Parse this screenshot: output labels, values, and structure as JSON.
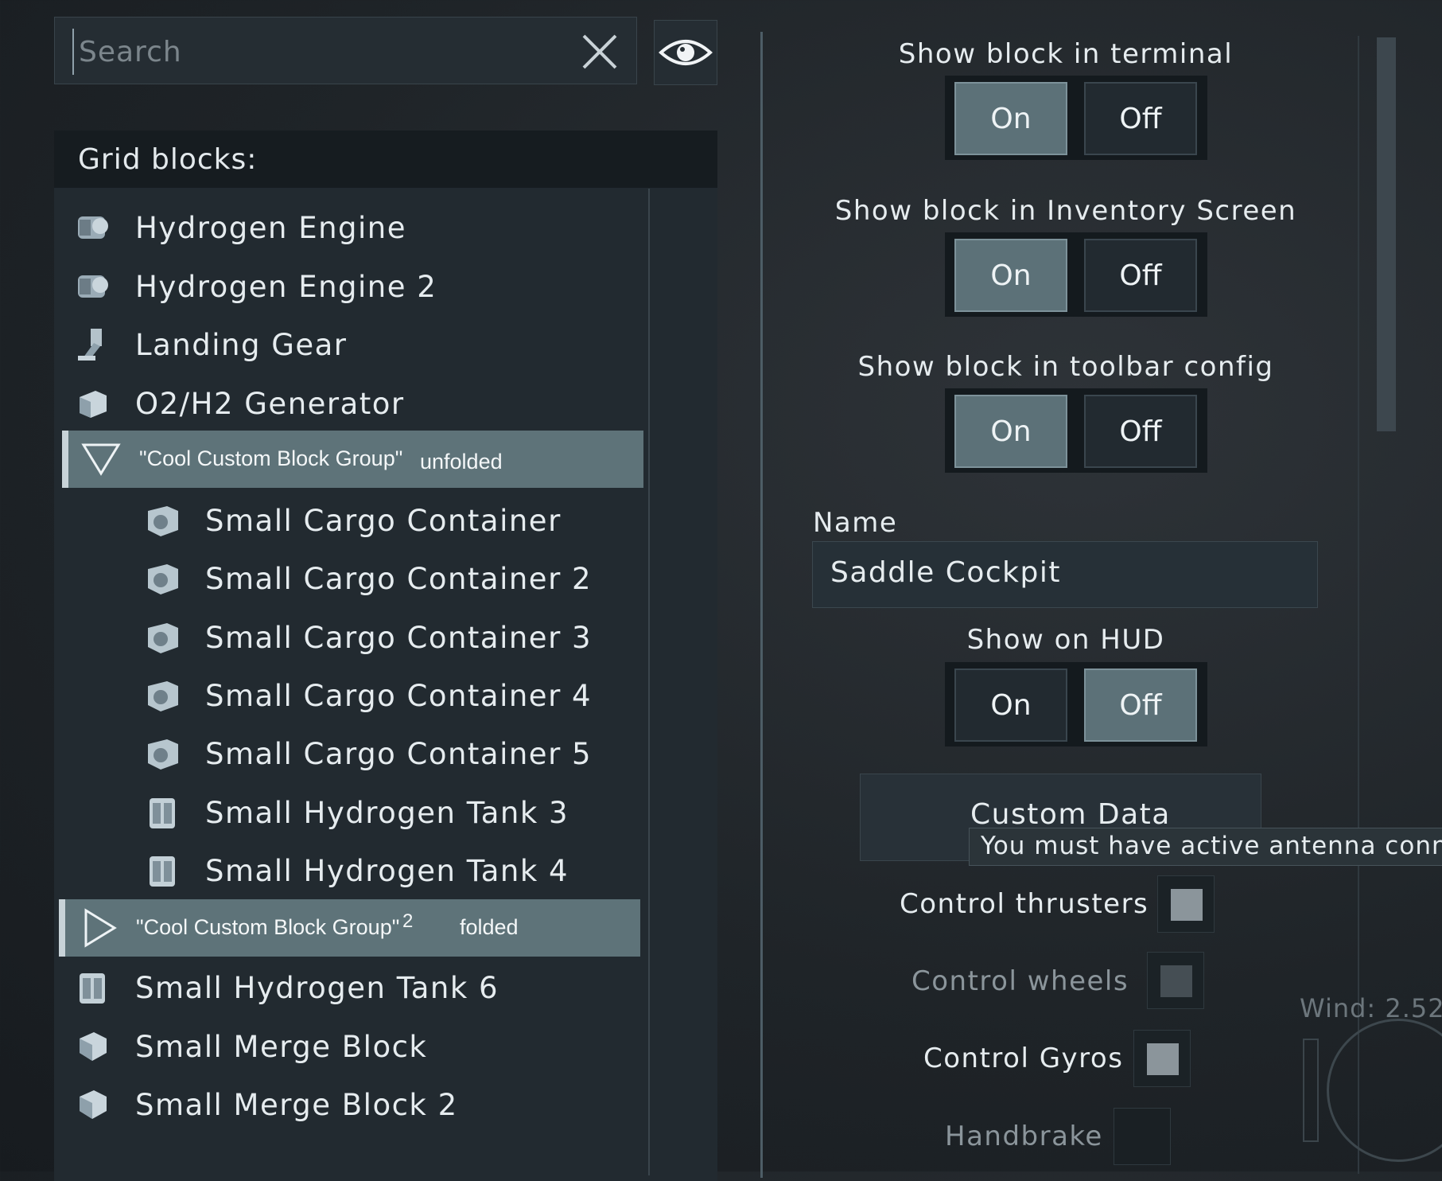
{
  "search": {
    "placeholder": "Search"
  },
  "list": {
    "header": "Grid blocks:",
    "items_top": [
      {
        "label": "Hydrogen Engine",
        "icon": "engine-icon"
      },
      {
        "label": "Hydrogen Engine 2",
        "icon": "engine-icon"
      },
      {
        "label": "Landing Gear",
        "icon": "landing-gear-icon"
      },
      {
        "label": "O2/H2 Generator",
        "icon": "generator-icon"
      }
    ],
    "group1": {
      "name": "\"Cool Custom Block Group\"",
      "state": "unfolded"
    },
    "group1_items": [
      {
        "label": "Small Cargo Container",
        "icon": "cargo-icon"
      },
      {
        "label": "Small Cargo Container 2",
        "icon": "cargo-icon"
      },
      {
        "label": "Small Cargo Container 3",
        "icon": "cargo-icon"
      },
      {
        "label": "Small Cargo Container 4",
        "icon": "cargo-icon"
      },
      {
        "label": "Small Cargo Container 5",
        "icon": "cargo-icon"
      },
      {
        "label": "Small Hydrogen Tank 3",
        "icon": "tank-icon"
      },
      {
        "label": "Small Hydrogen Tank 4",
        "icon": "tank-icon"
      }
    ],
    "group2": {
      "name": "\"Cool Custom Block Group\"",
      "suffix": "2",
      "state": "folded"
    },
    "items_bottom": [
      {
        "label": "Small Hydrogen Tank 6",
        "icon": "tank-icon"
      },
      {
        "label": "Small Merge Block",
        "icon": "merge-icon"
      },
      {
        "label": "Small Merge Block 2",
        "icon": "merge-icon"
      }
    ]
  },
  "options": {
    "show_terminal": {
      "title": "Show block in terminal",
      "on": "On",
      "off": "Off",
      "value": "On"
    },
    "show_inventory": {
      "title": "Show block in Inventory Screen",
      "on": "On",
      "off": "Off",
      "value": "On"
    },
    "show_toolbar": {
      "title": "Show block in toolbar config",
      "on": "On",
      "off": "Off",
      "value": "On"
    },
    "name_label": "Name",
    "name_value": "Saddle Cockpit",
    "show_hud": {
      "title": "Show on HUD",
      "on": "On",
      "off": "Off",
      "value": "Off"
    },
    "custom_data": "Custom Data",
    "tooltip": "You must have active antenna conne",
    "control_thrusters": {
      "label": "Control thrusters",
      "checked": false
    },
    "control_wheels": {
      "label": "Control wheels",
      "checked": false,
      "disabled": true
    },
    "control_gyros": {
      "label": "Control Gyros",
      "checked": false
    },
    "handbrake": {
      "label": "Handbrake",
      "checked": false,
      "disabled": true
    }
  },
  "hud": {
    "wind": "Wind: 2.52"
  },
  "colors": {
    "active": "#5c7178",
    "panel": "#222a30",
    "header": "#161c20",
    "text": "#e6ecef",
    "disabled_text": "#8b959b"
  }
}
